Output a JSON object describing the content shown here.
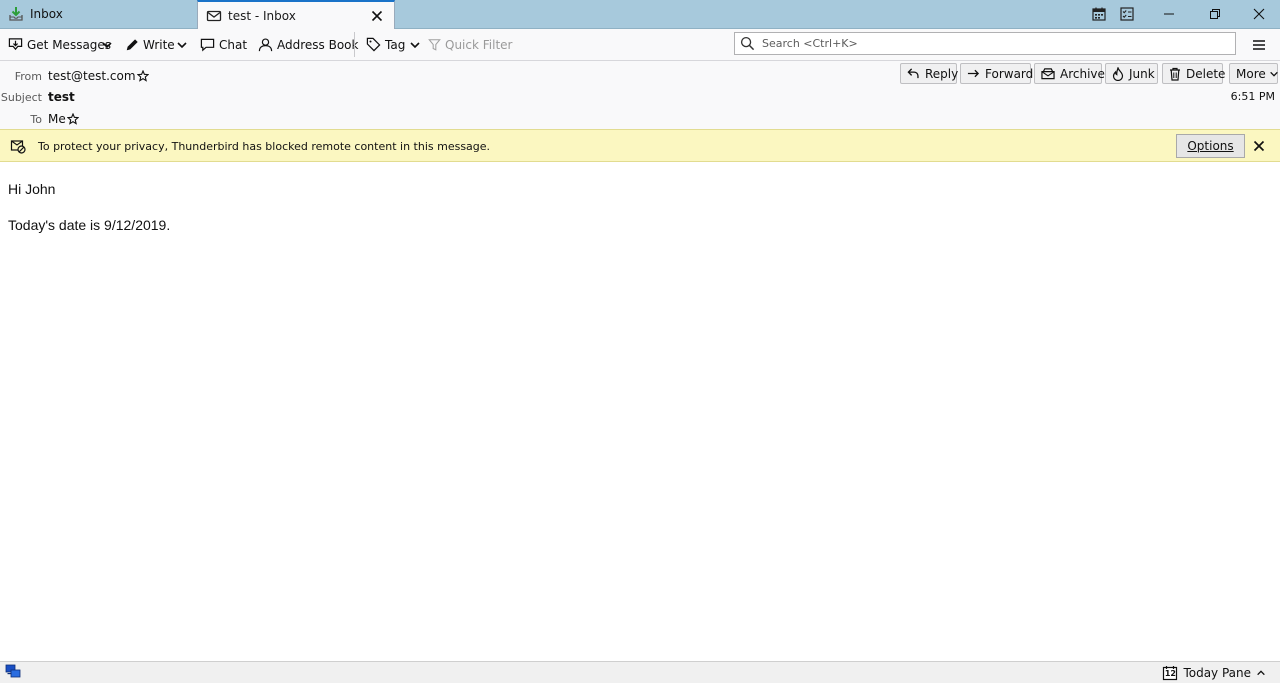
{
  "tabs": [
    {
      "label": "Inbox",
      "icon": "inbox-download-icon",
      "active": false
    },
    {
      "label": "test - Inbox",
      "icon": "envelope-icon",
      "active": true
    }
  ],
  "toolbar": {
    "get_messages": "Get Messages",
    "write": "Write",
    "chat": "Chat",
    "address_book": "Address Book",
    "tag": "Tag",
    "quick_filter": "Quick Filter",
    "search_placeholder": "Search <Ctrl+K>"
  },
  "message_header": {
    "from_label": "From",
    "from_value": "test@test.com",
    "subject_label": "Subject",
    "subject_value": "test",
    "to_label": "To",
    "to_value": "Me",
    "time": "6:51 PM",
    "buttons": {
      "reply": "Reply",
      "forward": "Forward",
      "archive": "Archive",
      "junk": "Junk",
      "delete": "Delete",
      "more": "More"
    }
  },
  "notification": {
    "text": "To protect your privacy, Thunderbird has blocked remote content in this message.",
    "options_label": "Options"
  },
  "message_body": {
    "line1": "Hi John",
    "line2": "Today's date is 9/12/2019."
  },
  "statusbar": {
    "today_pane_label": "Today Pane",
    "calendar_day": "12"
  },
  "colors": {
    "tabbar_bg": "#a7c9dc",
    "active_tab_accent": "#1a73c8",
    "notification_bg": "#fbf7c1"
  }
}
